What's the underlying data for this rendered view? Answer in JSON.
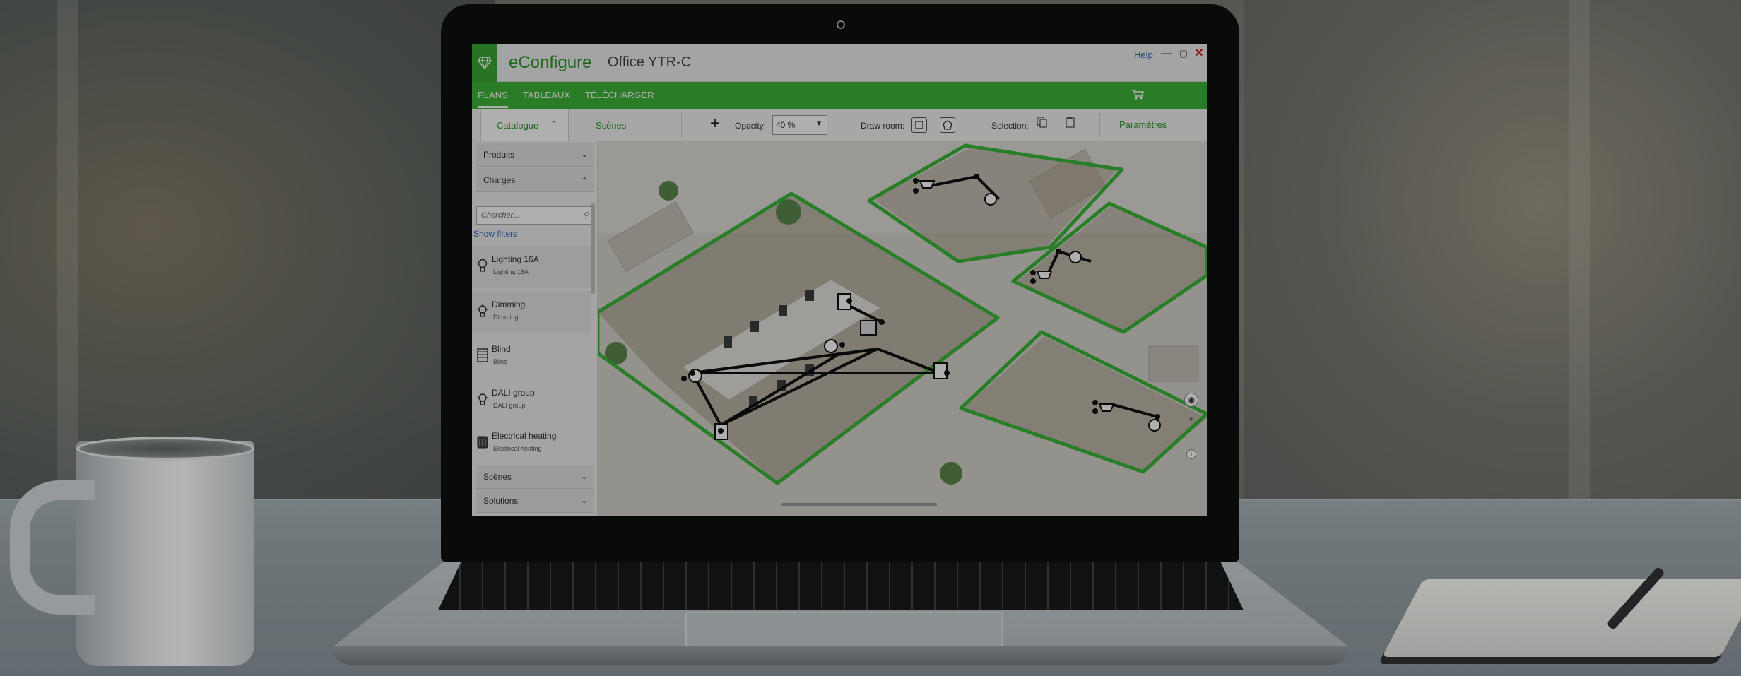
{
  "app": {
    "logo_icon": "diamond-logo-icon",
    "name": "eConfigure",
    "document_title": "Office YTR-C",
    "help_label": "Help",
    "accent_color": "#3fb53a"
  },
  "window_controls": {
    "minimize": "—",
    "maximize": "▢",
    "close": "✕"
  },
  "menu": {
    "items": [
      {
        "label": "PLANS",
        "active": true
      },
      {
        "label": "TABLEAUX",
        "active": false
      },
      {
        "label": "TÉLÉCHARGER",
        "active": false
      }
    ],
    "cart_icon": "cart-icon"
  },
  "toolbar": {
    "catalogue_tab": "Catalogue",
    "scenes_tab": "Scènes",
    "add_icon": "+",
    "opacity_label": "Opacity:",
    "opacity_value": "40 %",
    "draw_room_label": "Draw room:",
    "selection_label": "Selection:",
    "parametres_label": "Paramètres"
  },
  "sidebar": {
    "sections": {
      "produits": "Produits",
      "charges": "Charges",
      "scenes": "Scènes",
      "solutions": "Solutions"
    },
    "search_placeholder": "Chercher...",
    "show_filters": "Show filters",
    "items": [
      {
        "title": "Lighting 16A",
        "subtitle": "Lighting 16A",
        "icon": "bulb-icon"
      },
      {
        "title": "Dimming",
        "subtitle": "Dimming",
        "icon": "dimming-bulb-icon"
      },
      {
        "title": "Blind",
        "subtitle": "Blind",
        "icon": "blind-icon"
      },
      {
        "title": "DALI group",
        "subtitle": "DALI group",
        "icon": "dali-bulb-icon"
      },
      {
        "title": "Electrical heating",
        "subtitle": "Electrical heating",
        "icon": "heater-icon"
      }
    ]
  },
  "canvas": {
    "room_outline_color": "#3cb83a",
    "view_controls": [
      "eye-icon",
      "plus-icon",
      "info-icon"
    ]
  }
}
